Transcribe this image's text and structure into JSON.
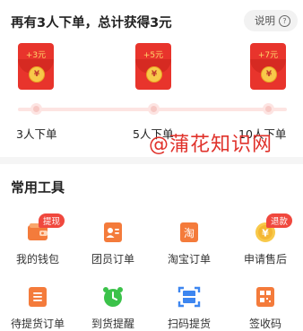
{
  "reward": {
    "title": "再有3人下单，总计获得3元",
    "explain_label": "说明",
    "explain_icon": "question-circle-icon",
    "milestones": [
      {
        "amount": "+3元",
        "label": "3人下单"
      },
      {
        "amount": "+5元",
        "label": "5人下单"
      },
      {
        "amount": "+7元",
        "label": "10人下单"
      }
    ],
    "coin_symbol": "¥"
  },
  "tools": {
    "title": "常用工具",
    "items": [
      {
        "label": "我的钱包",
        "icon": "wallet-icon",
        "badge": "提现"
      },
      {
        "label": "团员订单",
        "icon": "member-order-icon",
        "badge": ""
      },
      {
        "label": "淘宝订单",
        "icon": "taobao-order-icon",
        "badge": "",
        "glyph": "淘"
      },
      {
        "label": "申请售后",
        "icon": "after-sale-icon",
        "badge": "退款",
        "glyph": "¥"
      },
      {
        "label": "待提货订单",
        "icon": "pickup-order-icon",
        "badge": ""
      },
      {
        "label": "到货提醒",
        "icon": "alarm-clock-icon",
        "badge": ""
      },
      {
        "label": "扫码提货",
        "icon": "scan-icon",
        "badge": ""
      },
      {
        "label": "签收码",
        "icon": "receipt-code-icon",
        "badge": ""
      }
    ]
  },
  "watermark": "@蒲花知识网",
  "colors": {
    "accent_red": "#e8342c",
    "orange": "#f47b3b",
    "green": "#3bc24a",
    "blue": "#3d86f0",
    "yellow": "#f8c94a"
  }
}
